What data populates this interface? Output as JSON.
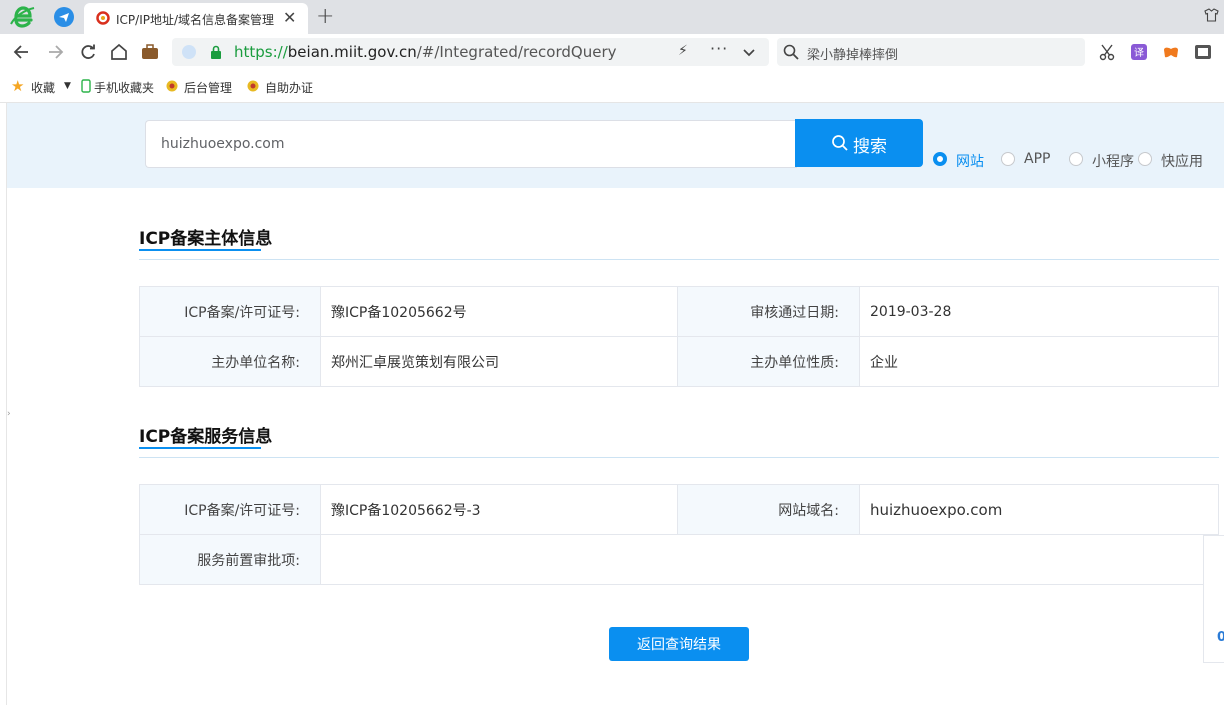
{
  "browser": {
    "tab_title": "ICP/IP地址/域名信息备案管理",
    "address": {
      "scheme": "https://",
      "host": "beian.miit.gov.cn",
      "path": "/#/Integrated/recordQuery"
    },
    "search_query": "梁小静掉棒摔倒",
    "bookmarks": [
      "收藏",
      "手机收藏夹",
      "后台管理",
      "自助办证"
    ]
  },
  "search": {
    "value": "huizhuoexpo.com",
    "button_label": "搜索",
    "types": [
      "网站",
      "APP",
      "小程序",
      "快应用"
    ],
    "selected_type": "网站"
  },
  "subject_section": {
    "title": "ICP备案主体信息",
    "rows": [
      {
        "k1": "ICP备案/许可证号:",
        "v1": "豫ICP备10205662号",
        "k2": "审核通过日期:",
        "v2": "2019-03-28"
      },
      {
        "k1": "主办单位名称:",
        "v1": "郑州汇卓展览策划有限公司",
        "k2": "主办单位性质:",
        "v2": "企业"
      }
    ]
  },
  "service_section": {
    "title": "ICP备案服务信息",
    "rows": [
      {
        "k1": "ICP备案/许可证号:",
        "v1": "豫ICP备10205662号-3",
        "k2": "网站域名:",
        "v2": "huizhuoexpo.com"
      },
      {
        "k1": "服务前置审批项:",
        "v1": ""
      }
    ]
  },
  "back_button": "返回查询结果",
  "float_value": "0",
  "colors": {
    "accent": "#0a8ff0",
    "band": "#e9f3fb",
    "key_cell": "#f4f9fd"
  }
}
